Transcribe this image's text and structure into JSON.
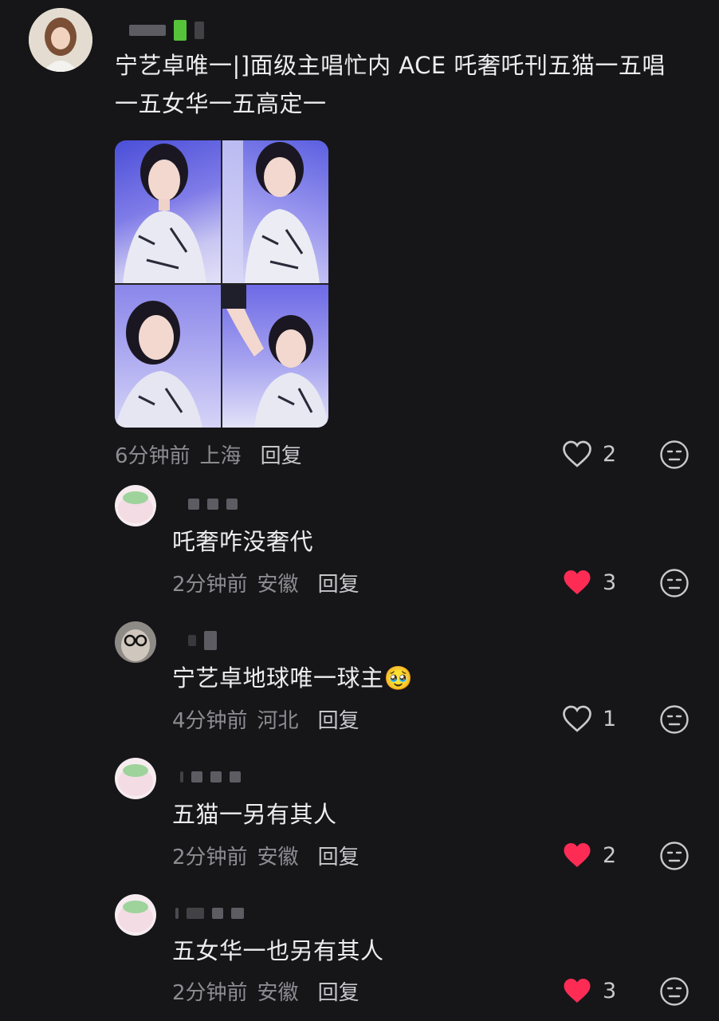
{
  "main_comment": {
    "text_line1": "宁艺卓唯一|]面级主唱忙内 ACE 吒奢吒刊五猫一五唱",
    "text_line2": "一五女华一五高定一",
    "time": "6分钟前",
    "location": "上海",
    "reply_label": "回复",
    "likes": "2",
    "liked": false
  },
  "replies": [
    {
      "text": "吒奢咋没奢代",
      "time": "2分钟前",
      "location": "安徽",
      "reply_label": "回复",
      "likes": "3",
      "liked": true
    },
    {
      "text": "宁艺卓地球唯一球主🥹",
      "time": "4分钟前",
      "location": "河北",
      "reply_label": "回复",
      "likes": "1",
      "liked": false
    },
    {
      "text": "五猫一另有其人",
      "time": "2分钟前",
      "location": "安徽",
      "reply_label": "回复",
      "likes": "2",
      "liked": true
    },
    {
      "text": "五女华一也另有其人",
      "time": "2分钟前",
      "location": "安徽",
      "reply_label": "回复",
      "likes": "3",
      "liked": true
    }
  ],
  "colors": {
    "background": "#161619",
    "like_red": "#fe2c55",
    "meta_gray": "#8c8c92"
  },
  "icons": {
    "like": "heart-icon",
    "dislike": "meh-face-icon"
  }
}
